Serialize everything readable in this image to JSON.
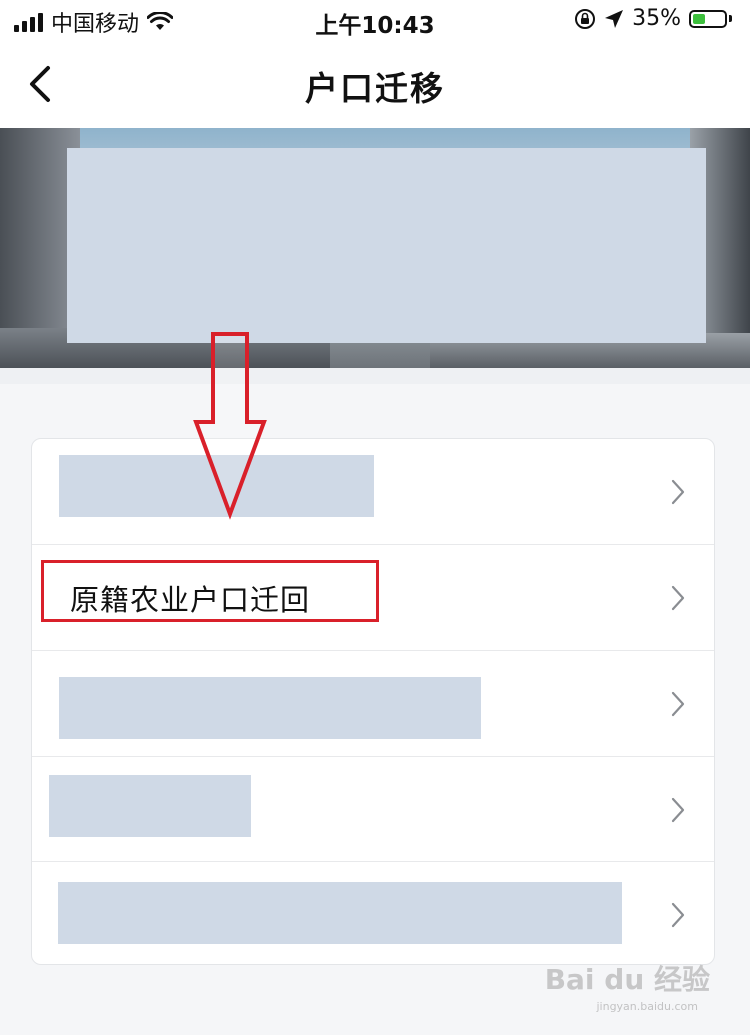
{
  "status_bar": {
    "carrier": "中国移动",
    "time": "上午10:43",
    "battery_percent": "35%"
  },
  "nav": {
    "title": "户口迁移"
  },
  "list": {
    "items": [
      {
        "label": ""
      },
      {
        "label": "原籍农业户口迁回"
      },
      {
        "label": ""
      },
      {
        "label": ""
      },
      {
        "label": ""
      }
    ]
  },
  "watermark": {
    "text": "Bai du 经验",
    "sub": "jingyan.baidu.com"
  },
  "colors": {
    "highlight": "#d9202a",
    "redaction": "#cfd9e6"
  }
}
